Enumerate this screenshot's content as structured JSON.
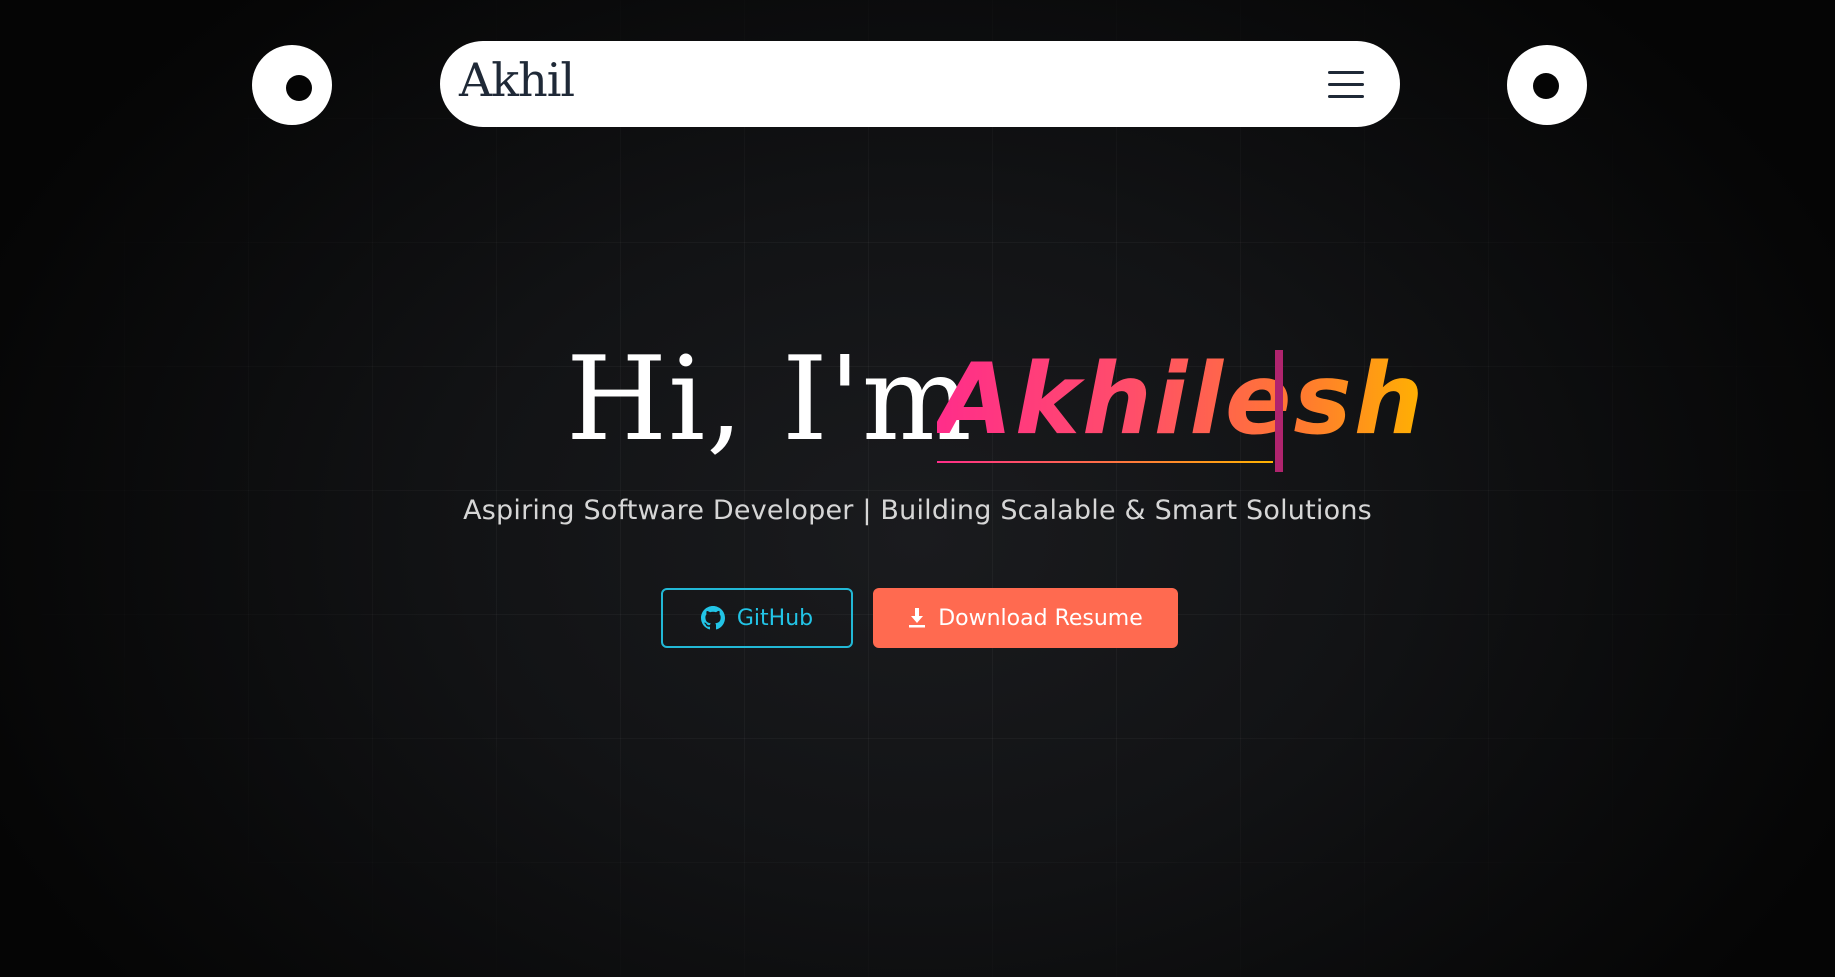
{
  "header": {
    "brand": "Akhil",
    "menu_icon": "hamburger-menu-icon"
  },
  "hero": {
    "greeting": "Hi, I'm",
    "name": "Akhilesh",
    "subtitle": "Aspiring Software Developer | Building Scalable & Smart Solutions"
  },
  "actions": {
    "github_label": "GitHub",
    "github_icon": "github-icon",
    "resume_label": "Download Resume",
    "resume_icon": "download-icon"
  },
  "colors": {
    "background": "#0a0a0b",
    "github_accent": "#22c4e6",
    "resume_button": "#ff6a50",
    "name_gradient_start": "#ff2d8a",
    "name_gradient_end": "#ffb300",
    "caret": "#b0246e"
  }
}
